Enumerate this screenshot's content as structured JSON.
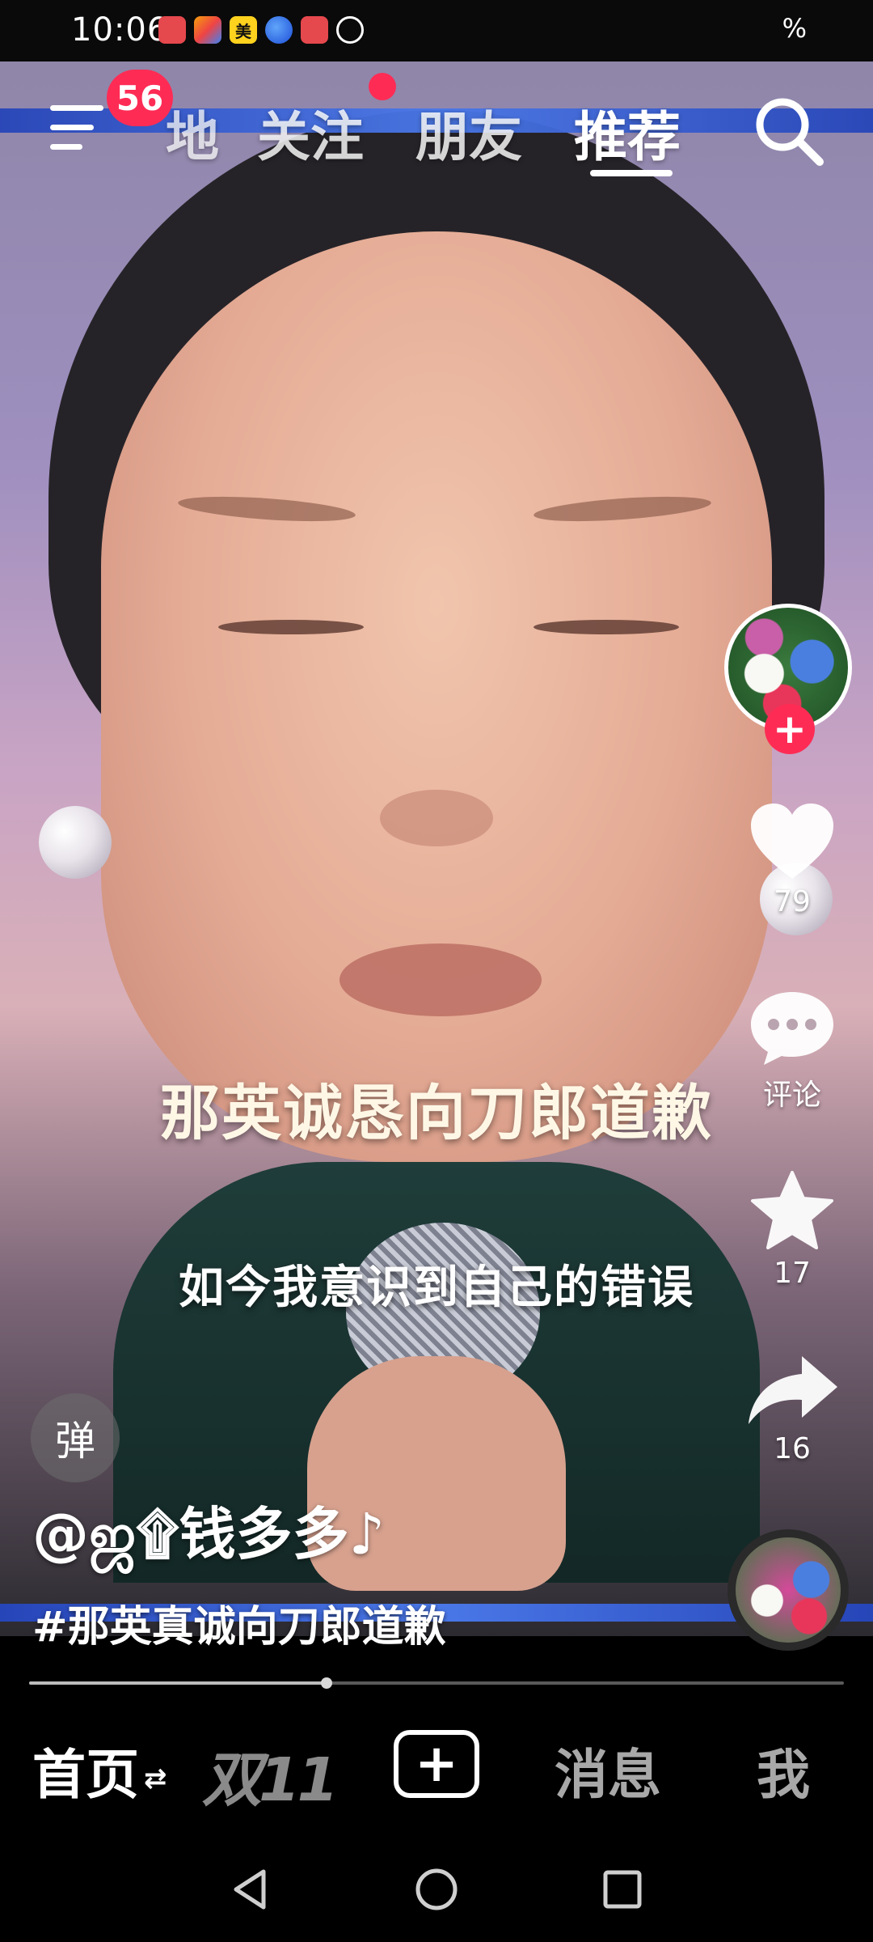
{
  "status_bar": {
    "time": "10:06",
    "icons": [
      "huawei-app-icon",
      "multicolor-app-icon",
      "meituan-icon",
      "browser-icon",
      "huawei-app-icon",
      "clock-icon"
    ],
    "meituan_label": "美",
    "right_text": "%"
  },
  "top_nav": {
    "notification_count": "56",
    "tabs": [
      {
        "label": "地"
      },
      {
        "label": "关注"
      },
      {
        "label": "朋友"
      },
      {
        "label": "推荐",
        "active": true
      }
    ]
  },
  "video": {
    "caption_main": "那英诚恳向刀郎道歉",
    "caption_sub": "如今我意识到自己的错误",
    "progress": 0.365
  },
  "actions": {
    "like_count": "79",
    "comment_label": "评论",
    "favorite_count": "17",
    "share_count": "16",
    "follow_symbol": "+"
  },
  "post": {
    "danmaku_label": "弹",
    "author": "@ஜ۩钱多多♪",
    "hashtag": "#那英真诚向刀郎道歉"
  },
  "bottom_nav": {
    "home": "首页",
    "home_arrows": "⇄",
    "double11": "双11",
    "create_symbol": "+",
    "messages": "消息",
    "me": "我"
  },
  "colors": {
    "accent": "#fe2c55",
    "band_blue": "#3a63d8",
    "background": "#000000"
  }
}
